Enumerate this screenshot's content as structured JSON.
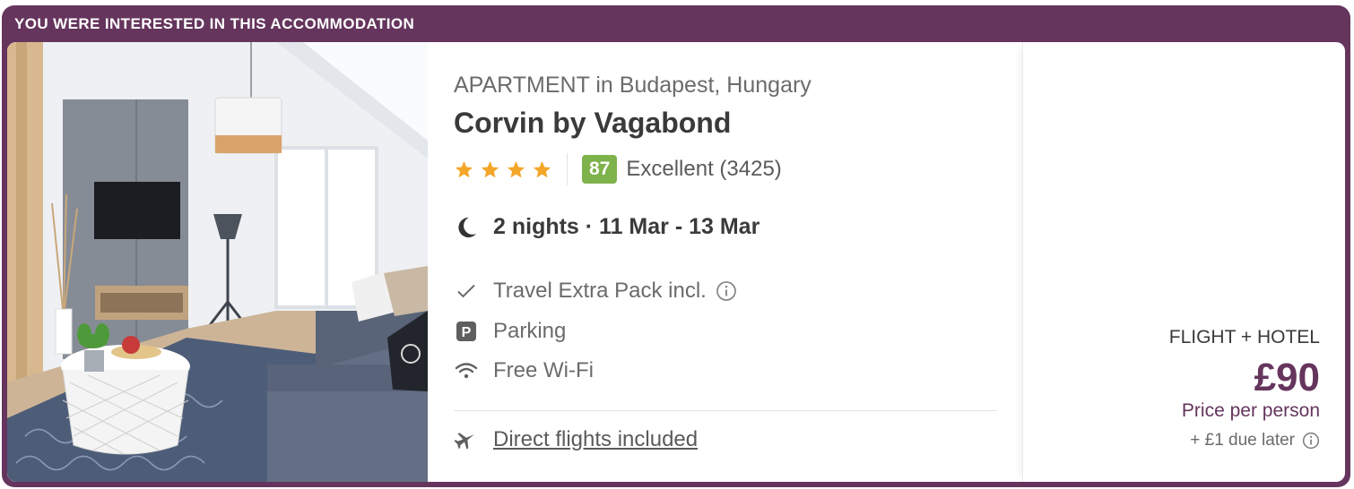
{
  "banner": {
    "text": "YOU WERE INTERESTED IN THIS ACCOMMODATION"
  },
  "hotel": {
    "type_location": "APARTMENT in Budapest, Hungary",
    "name": "Corvin by Vagabond",
    "stars": 4,
    "score": "87",
    "score_label": "Excellent (3425)",
    "stay": "2 nights · 11 Mar - 13 Mar",
    "features": [
      {
        "icon": "check-icon",
        "label": "Travel Extra Pack incl."
      },
      {
        "icon": "parking-icon",
        "label": "Parking"
      },
      {
        "icon": "wifi-icon",
        "label": "Free Wi-Fi"
      }
    ],
    "flights_link": "Direct flights included"
  },
  "price": {
    "type": "FLIGHT + HOTEL",
    "value": "£90",
    "per": "Price per person",
    "due_later": "+ £1 due later"
  },
  "colors": {
    "brand": "#65355d",
    "score_bg": "#7eb24a",
    "star": "#f4a62a"
  }
}
